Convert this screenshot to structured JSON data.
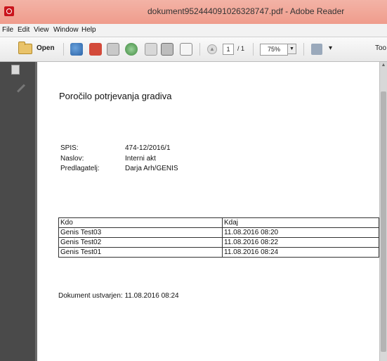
{
  "window": {
    "title": "dokument952444091026328747.pdf - Adobe Reader"
  },
  "menu": {
    "items": [
      "File",
      "Edit",
      "View",
      "Window",
      "Help"
    ]
  },
  "toolbar": {
    "open_label": "Open",
    "page_current": "1",
    "page_total": "/ 1",
    "zoom": "75%",
    "tools_label": "Too"
  },
  "document": {
    "title": "Poročilo potrjevanja gradiva",
    "meta": [
      {
        "label": "SPIS:",
        "value": "474-12/2016/1"
      },
      {
        "label": "Naslov:",
        "value": "Interni akt"
      },
      {
        "label": "Predlagatelj:",
        "value": "Darja Arh/GENIS"
      }
    ],
    "table": {
      "headers": [
        "Kdo",
        "Kdaj"
      ],
      "rows": [
        [
          "Genis Test03",
          "11.08.2016 08:20"
        ],
        [
          "Genis Test02",
          "11.08.2016 08:22"
        ],
        [
          "Genis Test01",
          "11.08.2016 08:24"
        ]
      ]
    },
    "footer": "Dokument ustvarjen: 11.08.2016 08:24"
  },
  "colors": {
    "titlebar": "#ef9c8c",
    "nav_pane": "#4a4a4a",
    "page_background": "#ffffff"
  },
  "icons": {
    "app": "adobe-reader-icon",
    "toolbar": [
      "folder-icon",
      "globe-icon",
      "create-pdf-icon",
      "edit-icon",
      "cloud-icon",
      "save-icon",
      "print-icon",
      "email-icon",
      "previous-page-icon",
      "fit-page-icon"
    ]
  }
}
